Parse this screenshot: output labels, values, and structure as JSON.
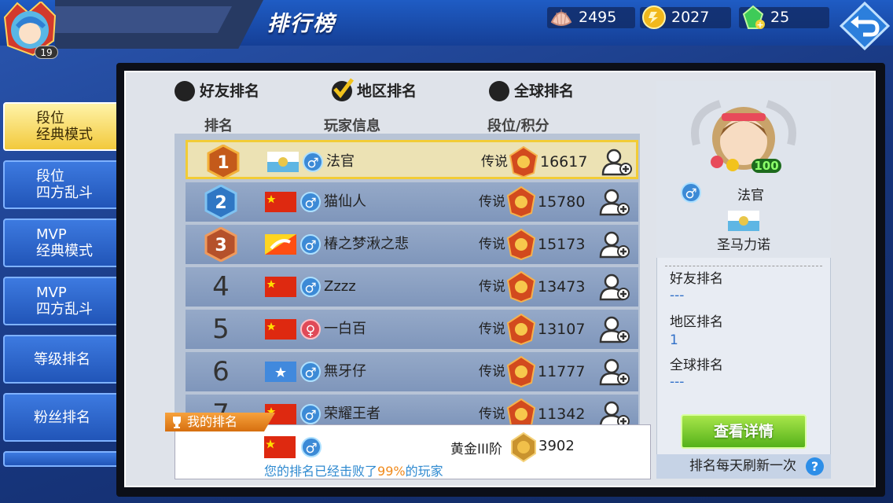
{
  "header": {
    "title": "排行榜",
    "player_level": "19",
    "currencies": [
      {
        "name": "shell",
        "value": "2495"
      },
      {
        "name": "gold-coin",
        "value": "2027"
      },
      {
        "name": "emerald-gem",
        "value": "25"
      }
    ]
  },
  "sidebar": {
    "items": [
      {
        "line1": "段位",
        "line2": "经典模式",
        "active": true
      },
      {
        "line1": "段位",
        "line2": "四方乱斗",
        "active": false
      },
      {
        "line1": "MVP",
        "line2": "经典模式",
        "active": false
      },
      {
        "line1": "MVP",
        "line2": "四方乱斗",
        "active": false
      },
      {
        "line1": "等级排名",
        "line2": "",
        "active": false
      },
      {
        "line1": "粉丝排名",
        "line2": "",
        "active": false
      }
    ]
  },
  "filters": [
    {
      "label": "好友排名",
      "selected": false
    },
    {
      "label": "地区排名",
      "selected": true
    },
    {
      "label": "全球排名",
      "selected": false
    }
  ],
  "table": {
    "headers": [
      "排名",
      "玩家信息",
      "段位/积分"
    ],
    "rows": [
      {
        "rank": "1",
        "flag": "san-marino",
        "gender": "male",
        "name": "法官",
        "tier": "传说",
        "score": "16617"
      },
      {
        "rank": "2",
        "flag": "china",
        "gender": "male",
        "name": "猫仙人",
        "tier": "传说",
        "score": "15780"
      },
      {
        "rank": "3",
        "flag": "bhutan",
        "gender": "male",
        "name": "椿之梦湫之悲",
        "tier": "传说",
        "score": "15173"
      },
      {
        "rank": "4",
        "flag": "china",
        "gender": "male",
        "name": "Zzzz",
        "tier": "传说",
        "score": "13473"
      },
      {
        "rank": "5",
        "flag": "china",
        "gender": "female",
        "name": "一白百",
        "tier": "传说",
        "score": "13107"
      },
      {
        "rank": "6",
        "flag": "somalia",
        "gender": "male",
        "name": "無牙仔",
        "tier": "传说",
        "score": "11777"
      },
      {
        "rank": "7",
        "flag": "china",
        "gender": "male",
        "name": "荣耀王者",
        "tier": "传说",
        "score": "11342"
      }
    ]
  },
  "my_rank": {
    "label": "我的排名",
    "flag": "china",
    "gender": "male",
    "tier": "黄金III阶",
    "score": "3902",
    "msg_prefix": "您的排名已经击败了",
    "msg_percent": "99%",
    "msg_suffix": "的玩家"
  },
  "profile": {
    "name": "法官",
    "gender": "male",
    "region": "圣马力诺",
    "level": "100",
    "friend_rank_label": "好友排名",
    "friend_rank_value": "---",
    "region_rank_label": "地区排名",
    "region_rank_value": "1",
    "global_rank_label": "全球排名",
    "global_rank_value": "---",
    "details_button": "查看详情",
    "refresh_note": "排名每天刷新一次"
  }
}
